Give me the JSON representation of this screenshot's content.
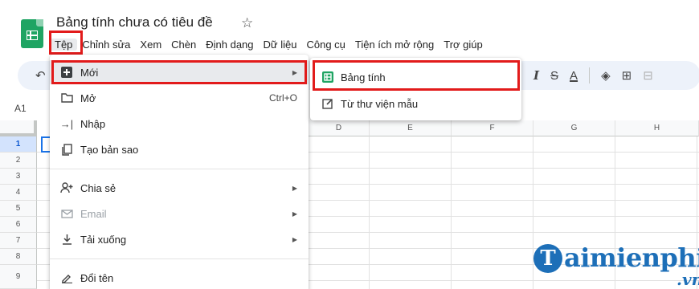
{
  "header": {
    "title": "Bảng tính chưa có tiêu đề",
    "star_icon": "star-outline-icon",
    "menu": [
      "Tệp",
      "Chỉnh sửa",
      "Xem",
      "Chèn",
      "Định dạng",
      "Dữ liệu",
      "Công cụ",
      "Tiện ích mở rộng",
      "Trợ giúp"
    ]
  },
  "toolbar": {
    "undo_icon": "undo-icon",
    "italic": "I",
    "strike": "S",
    "text_color": "A"
  },
  "namebox": "A1",
  "grid": {
    "columns": [
      "D",
      "E",
      "F",
      "G",
      "H"
    ],
    "rows": [
      "1",
      "2",
      "3",
      "4",
      "5",
      "6",
      "7",
      "8",
      "9"
    ]
  },
  "file_menu": {
    "items": [
      {
        "label": "Mới",
        "icon": "new-sheet-icon",
        "submenu": true
      },
      {
        "label": "Mở",
        "icon": "folder-icon",
        "shortcut": "Ctrl+O"
      },
      {
        "label": "Nhập",
        "icon": "import-icon"
      },
      {
        "label": "Tạo bản sao",
        "icon": "copy-icon"
      },
      {
        "label": "Chia sẻ",
        "icon": "share-person-icon",
        "submenu": true
      },
      {
        "label": "Email",
        "icon": "email-icon",
        "submenu": true,
        "disabled": true
      },
      {
        "label": "Tải xuống",
        "icon": "download-icon",
        "submenu": true
      },
      {
        "label": "Đổi tên",
        "icon": "rename-icon"
      }
    ]
  },
  "submenu_new": {
    "items": [
      {
        "label": "Bảng tính",
        "icon": "sheets-icon"
      },
      {
        "label": "Từ thư viện mẫu",
        "icon": "template-icon"
      }
    ]
  },
  "watermark": {
    "letter": "T",
    "text": "aimienphi",
    "suffix": ".vn"
  },
  "colors": {
    "sheets_green": "#1fa463",
    "highlight_red": "#e21b1b",
    "toolbar_bg": "#edf2fa",
    "watermark_blue": "#1d6fb8"
  }
}
